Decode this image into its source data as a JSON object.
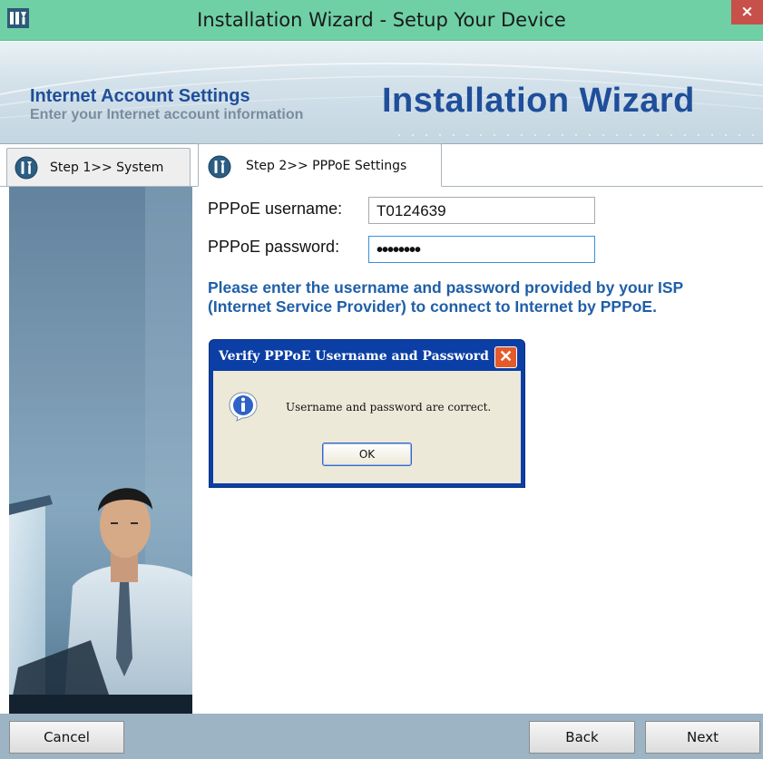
{
  "window": {
    "title": "Installation Wizard - Setup Your Device",
    "close_label": "×",
    "icon": "app-icon"
  },
  "banner": {
    "heading": "Internet Account Settings",
    "subheading": "Enter your Internet account information",
    "logo_text": "Installation Wizard"
  },
  "tabs": [
    {
      "label": "Step 1>> System",
      "active": false,
      "icon": "wrench-icon"
    },
    {
      "label": "Step 2>> PPPoE Settings",
      "active": true,
      "icon": "wrench-icon"
    }
  ],
  "form": {
    "username_label": "PPPoE username:",
    "username_value": "T0124639",
    "password_label": "PPPoE password:",
    "password_value": "••••••••",
    "info_line1": "Please enter the username and password provided by your ISP",
    "info_line2": "(Internet Service Provider) to connect to Internet by PPPoE."
  },
  "dialog": {
    "title": "Verify PPPoE Username and Password",
    "message": "Username and password are correct.",
    "ok_label": "OK",
    "close_label": "✕",
    "icon": "info-icon"
  },
  "buttons": {
    "cancel": "Cancel",
    "back": "Back",
    "next": "Next"
  },
  "colors": {
    "titlebar": "#6fd0a5",
    "close": "#c7504a",
    "accent_blue": "#1f4e9a",
    "info_text": "#1f5fa8",
    "dialog_title_bar": "#0b3fa6",
    "bottom_bar": "#9cb4c4"
  }
}
